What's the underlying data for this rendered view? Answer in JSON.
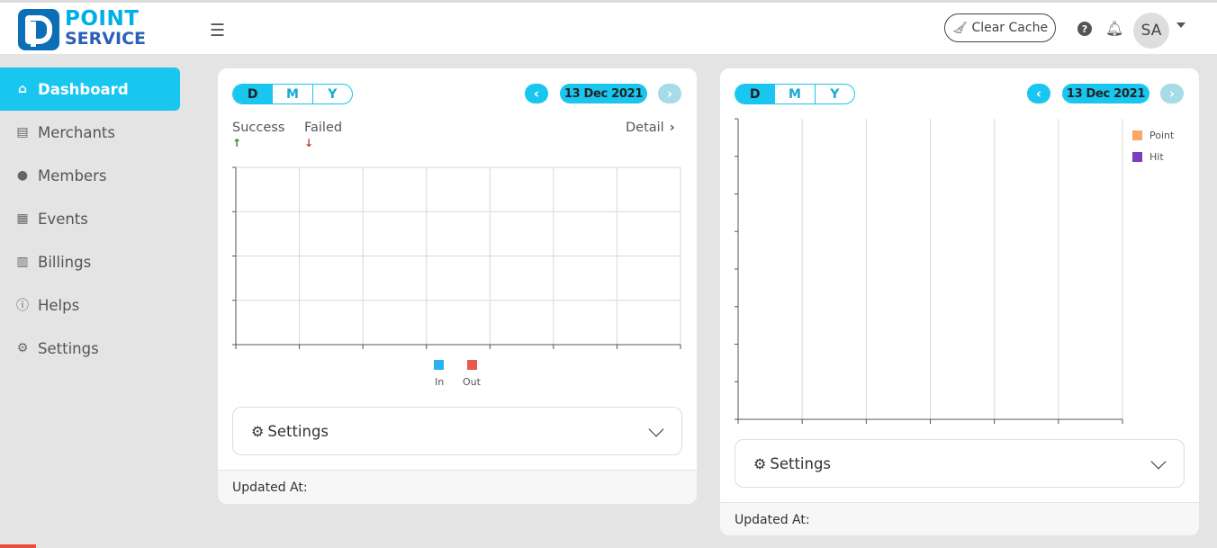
{
  "header": {
    "logo_line1": "POINT",
    "logo_line2": "SERVICE",
    "clear_cache_label": "Clear Cache",
    "avatar_initials": "SA"
  },
  "sidebar": {
    "items": [
      {
        "label": "Dashboard",
        "icon": "home-icon",
        "active": true
      },
      {
        "label": "Merchants",
        "icon": "store-icon"
      },
      {
        "label": "Members",
        "icon": "users-icon"
      },
      {
        "label": "Events",
        "icon": "calculator-icon"
      },
      {
        "label": "Billings",
        "icon": "receipt-icon"
      },
      {
        "label": "Helps",
        "icon": "question-circle-icon"
      },
      {
        "label": "Settings",
        "icon": "gear-icon"
      }
    ]
  },
  "colors": {
    "accent": "#19c6f0",
    "series_in": "#2bb1f3",
    "series_out": "#ea5a4c",
    "series_point": "#f6a86a",
    "series_hit": "#7a3fbf"
  },
  "card_left": {
    "period_options": [
      "D",
      "M",
      "Y"
    ],
    "selected_period": "D",
    "date": "13 Dec 2021",
    "success_label": "Success",
    "failed_label": "Failed",
    "detail_label": "Detail",
    "settings_label": "Settings",
    "updated_label": "Updated At:"
  },
  "card_right": {
    "period_options": [
      "D",
      "M",
      "Y"
    ],
    "selected_period": "D",
    "date": "13 Dec 2021",
    "settings_label": "Settings",
    "updated_label": "Updated At:"
  },
  "chart_data": [
    {
      "type": "bar",
      "categories": [
        "",
        "",
        "",
        "",
        "",
        "",
        ""
      ],
      "series": [
        {
          "name": "In",
          "values": []
        },
        {
          "name": "Out",
          "values": []
        }
      ],
      "legend": "bottom",
      "grid": true
    },
    {
      "type": "bar",
      "categories": [
        "",
        "",
        "",
        "",
        "",
        ""
      ],
      "series": [
        {
          "name": "Point",
          "values": []
        },
        {
          "name": "Hit",
          "values": []
        }
      ],
      "legend": "top-right",
      "grid": true
    }
  ]
}
